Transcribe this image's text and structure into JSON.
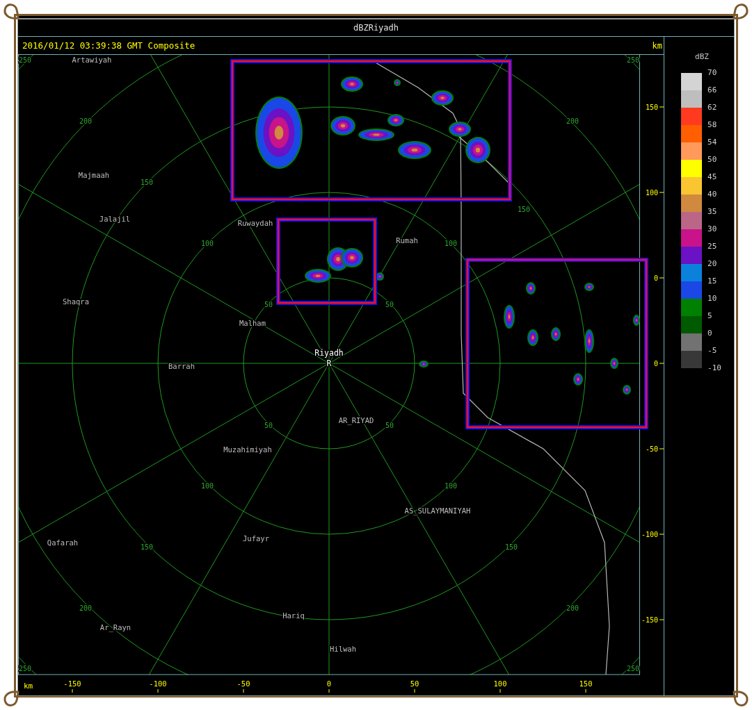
{
  "window": {
    "title": "dBZRiyadh"
  },
  "header": {
    "timestamp": "2016/01/12 03:39:38 GMT Composite",
    "unit": "km"
  },
  "map": {
    "places": [
      {
        "name": "Artawiyah",
        "kind": "town"
      },
      {
        "name": "Majmaah",
        "kind": "town"
      },
      {
        "name": "Jalajil",
        "kind": "town"
      },
      {
        "name": "Ruwaydah",
        "kind": "town"
      },
      {
        "name": "Rumah",
        "kind": "town"
      },
      {
        "name": "Shaqra",
        "kind": "town"
      },
      {
        "name": "Malham",
        "kind": "town"
      },
      {
        "name": "Riyadh",
        "kind": "radar"
      },
      {
        "name": "R",
        "kind": "radar"
      },
      {
        "name": "Barrah",
        "kind": "town"
      },
      {
        "name": "AR_RIYAD",
        "kind": "town"
      },
      {
        "name": "Muzahimiyah",
        "kind": "town"
      },
      {
        "name": "AS_SULAYMANIYAH",
        "kind": "town"
      },
      {
        "name": "Jufayr",
        "kind": "town"
      },
      {
        "name": "Qafarah",
        "kind": "town"
      },
      {
        "name": "Hariq",
        "kind": "town"
      },
      {
        "name": "Ar_Rayn",
        "kind": "town"
      },
      {
        "name": "Hilwah",
        "kind": "town"
      }
    ],
    "range_labels": [
      "250",
      "250",
      "200",
      "200",
      "150",
      "150",
      "100",
      "100",
      "50",
      "50",
      "50",
      "50",
      "100",
      "100",
      "150",
      "150",
      "200",
      "200",
      "250",
      "250"
    ]
  },
  "y_axis": {
    "ticks": [
      "150",
      "100",
      "0",
      "0",
      "-50",
      "-100",
      "-150"
    ]
  },
  "x_axis": {
    "unit": "km",
    "ticks": [
      "-150",
      "-100",
      "-50",
      "0",
      "50",
      "100",
      "150"
    ]
  },
  "legend": {
    "title": "dBZ",
    "bins": [
      {
        "color": "#d4d4d4"
      },
      {
        "color": "#bebebe"
      },
      {
        "color": "#ff3a1e"
      },
      {
        "color": "#ff5f00"
      },
      {
        "color": "#ff9a5a"
      },
      {
        "color": "#ffff00"
      },
      {
        "color": "#f9c531"
      },
      {
        "color": "#d0893f"
      },
      {
        "color": "#bc6687"
      },
      {
        "color": "#c8138a"
      },
      {
        "color": "#6a12c4"
      },
      {
        "color": "#0a82dc"
      },
      {
        "color": "#1a48e6"
      },
      {
        "color": "#008000"
      },
      {
        "color": "#005a00"
      },
      {
        "color": "#727272"
      },
      {
        "color": "#383838"
      }
    ],
    "labels": [
      "70",
      "66",
      "62",
      "58",
      "54",
      "50",
      "45",
      "40",
      "35",
      "30",
      "25",
      "20",
      "15",
      "10",
      "5",
      "0",
      "-5",
      "-10"
    ]
  }
}
